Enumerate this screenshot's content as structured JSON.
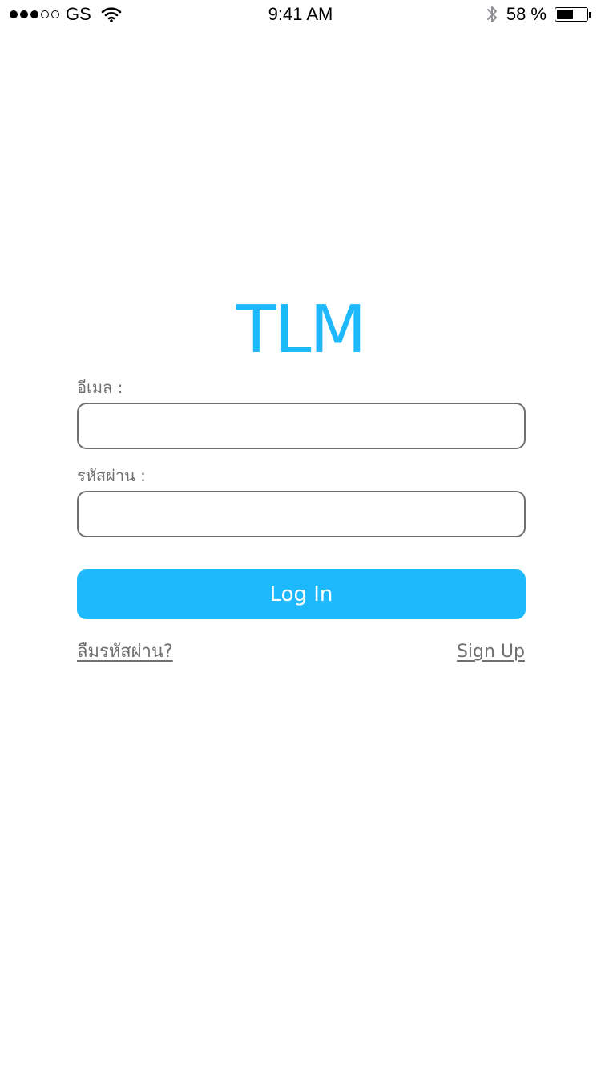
{
  "status_bar": {
    "signal_bars_filled": 3,
    "signal_bars_total": 5,
    "carrier": "GS",
    "wifi_icon": "wifi-icon",
    "time": "9:41 AM",
    "bluetooth_icon": "bluetooth-icon",
    "battery_percent_label": "58 %",
    "battery_level": 0.58
  },
  "app": {
    "logo_text": "TLM",
    "brand_color": "#1eb9fd"
  },
  "login_form": {
    "email_label": "อีเมล :",
    "email_value": "",
    "email_placeholder": "",
    "password_label": "รหัสผ่าน :",
    "password_value": "",
    "password_placeholder": "",
    "login_button_label": "Log In",
    "forgot_password_link": "ลืมรหัสผ่าน?",
    "sign_up_link": "Sign Up"
  }
}
